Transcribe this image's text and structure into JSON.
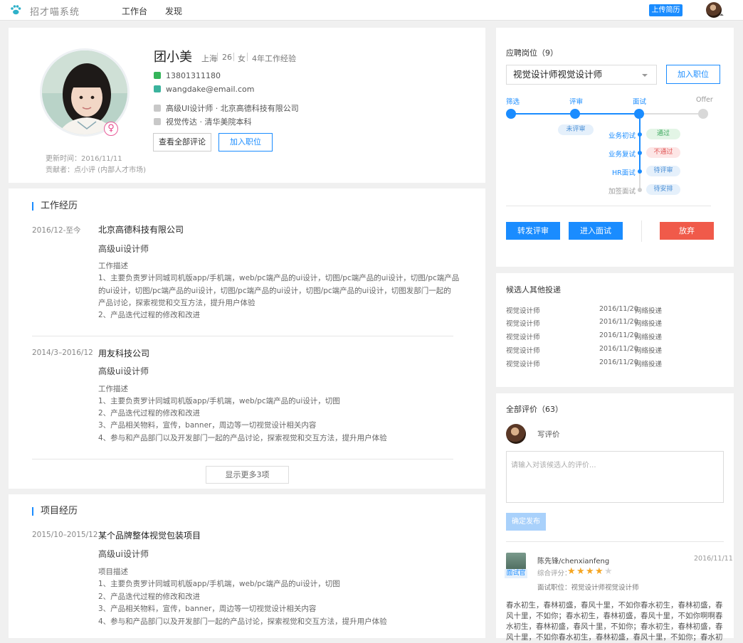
{
  "topbar": {
    "logo_text": "招才喵系统",
    "nav": [
      "工作台",
      "发现"
    ],
    "upload_label": "上传简历"
  },
  "profile": {
    "name": "团小美",
    "city": "上海",
    "age": "26",
    "gender": "女",
    "experience": "4年工作经验",
    "gender_symbol": "♀",
    "phone": "13801311180",
    "email": "wangdake@email.com",
    "job": "高级UI设计师 · 北京高德科技有限公司",
    "education": "视觉传达 · 清华美院本科",
    "view_reviews_label": "查看全部评论",
    "add_job_label": "加入职位",
    "updated": "更新时间：2016/11/11",
    "contributor": "贡献者：点小评 (内部人才市场)"
  },
  "work": {
    "title": "工作经历",
    "entries": [
      {
        "date": "2016/12-至今",
        "company": "北京高德科技有限公司",
        "role": "高级ui设计师",
        "desc_title": "工作描述",
        "lines": [
          "1、主要负责罗计同城司机版app/手机端，web/pc端产品的ui设计，切图/pc端产品的ui设计，切图/pc端产品",
          "的ui设计，切图/pc端产品的ui设计，切图/pc端产品的ui设计，切图/pc端产品的ui设计，切图发部门一起的",
          "产品讨论，探索视觉和交互方法，提升用户体验",
          "2、产品迭代过程的修改和改进"
        ]
      },
      {
        "date": "2014/3–2016/12",
        "company": "用友科技公司",
        "role": "高级ui设计师",
        "desc_title": "工作描述",
        "lines": [
          "1、主要负责罗计同城司机版app/手机端，web/pc端产品的ui设计，切图",
          "2、产品迭代过程的修改和改进",
          "3、产品相关物料，宣传，banner，周边等一切视觉设计相关内容",
          "4、参与和产品部门以及开发部门一起的产品讨论，探索视觉和交互方法，提升用户体验"
        ]
      }
    ],
    "more_label": "显示更多3项"
  },
  "project": {
    "title": "项目经历",
    "date": "2015/10–2015/12",
    "name": "某个品牌整体视觉包装项目",
    "role": "高级ui设计师",
    "desc_title": "项目描述",
    "lines": [
      "1、主要负责罗计同城司机版app/手机端，web/pc端产品的ui设计，切图",
      "2、产品迭代过程的修改和改进",
      "3、产品相关物料，宣传，banner，周边等一切视觉设计相关内容",
      "4、参与和产品部门以及开发部门一起的产品讨论，探索视觉和交互方法，提升用户体验"
    ]
  },
  "position": {
    "title": "应聘岗位（9）",
    "selected": "视觉设计师视觉设计师",
    "add_label": "加入职位",
    "steps": [
      "筛选",
      "评审",
      "面试",
      "Offer"
    ],
    "review_tag": "未评审",
    "interviews": [
      {
        "name": "业务初试",
        "status": "通过"
      },
      {
        "name": "业务复试",
        "status": "不通过"
      },
      {
        "name": "HR面试",
        "status": "待评审"
      },
      {
        "name": "加签面试",
        "status": "待安排"
      }
    ],
    "forward_label": "转发评审",
    "interview_label": "进入面试",
    "abandon_label": "放弃"
  },
  "other_apps": {
    "title": "候选人其他投递",
    "rows": [
      {
        "job": "视觉设计师",
        "date": "2016/11/20",
        "channel": "网络投递"
      },
      {
        "job": "视觉设计师",
        "date": "2016/11/20",
        "channel": "网络投递"
      },
      {
        "job": "视觉设计师",
        "date": "2016/11/20",
        "channel": "网络投递"
      },
      {
        "job": "视觉设计师",
        "date": "2016/11/20",
        "channel": "网络投递"
      },
      {
        "job": "视觉设计师",
        "date": "2016/11/20",
        "channel": "网络投递"
      }
    ]
  },
  "reviews": {
    "title": "全部评价（63）",
    "write_label": "写评价",
    "placeholder": "请输入对该候选人的评价...",
    "publish_label": "确定发布",
    "item": {
      "author": "陈先锋/chenxianfeng",
      "badge": "面试官",
      "date": "2016/11/11",
      "rating_label": "综合评分：",
      "rating": 4,
      "rating_max": 5,
      "position": "面试职位：视觉设计师视觉设计师",
      "text": "春水初生，春林初盛，春风十里，不如你春水初生，春林初盛，春风十里，不如你；春水初生，春林初盛，春风十里，不如你啊啊春水初生，春林初盛，春风十里，不如你；春水初生，春林初盛，春风十里，不如你春水初生，春林初盛，春风十里，不如你；春水初"
    }
  },
  "colors": {
    "accent": "#1a8cff",
    "danger": "#f05a4a",
    "pass_bg": "#e3f5e6",
    "fail_bg": "#fde6e6",
    "pending_bg": "#e5f0fb"
  }
}
